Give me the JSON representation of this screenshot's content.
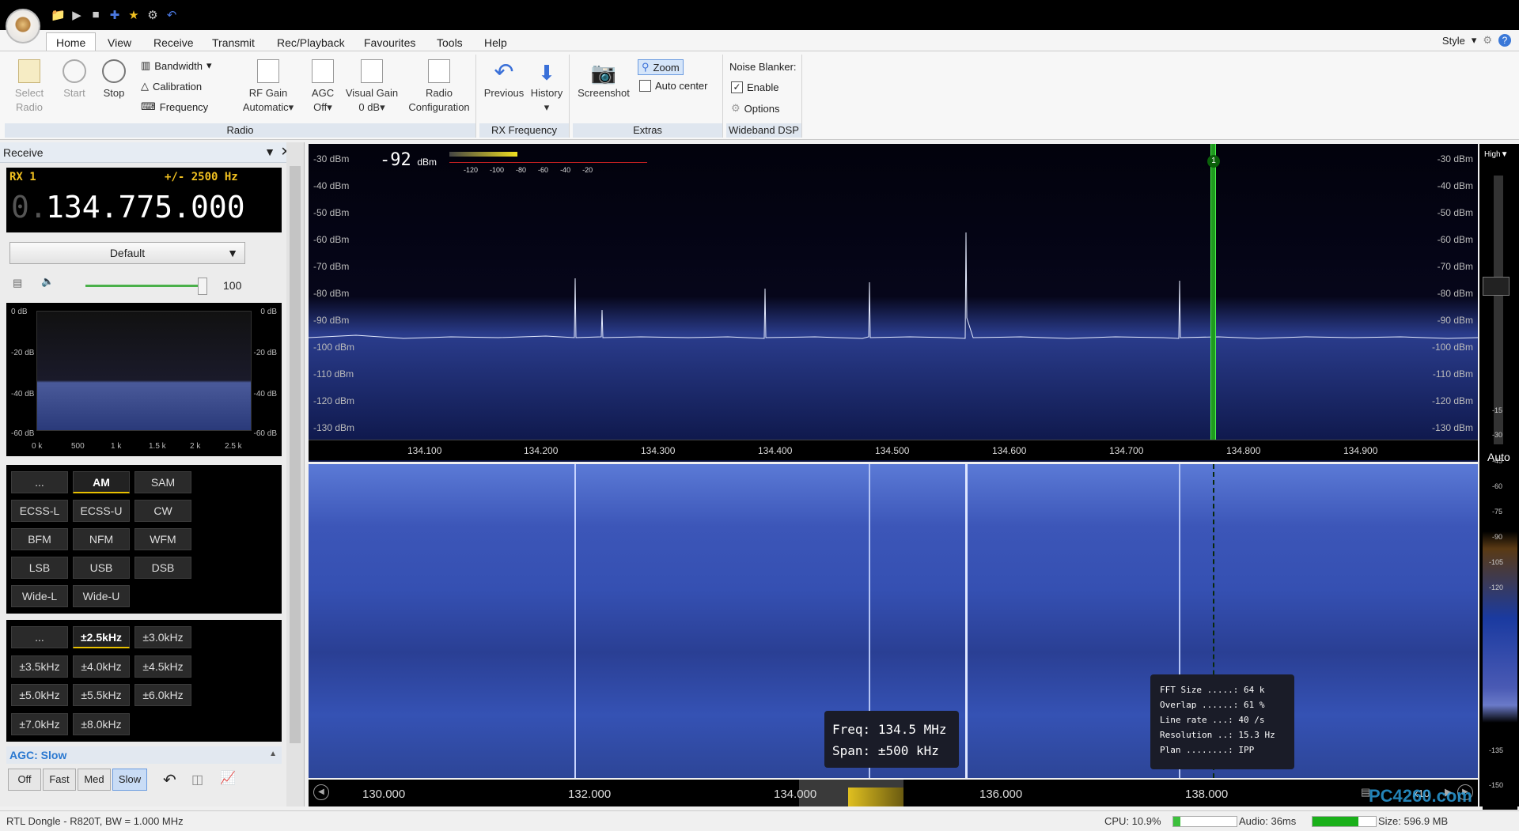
{
  "qat_icons": [
    "folder-icon",
    "play-icon",
    "stop-icon",
    "add-icon",
    "star-icon",
    "gear-icon",
    "undo-icon"
  ],
  "menu": {
    "tabs": [
      "Home",
      "View",
      "Receive",
      "Transmit",
      "Rec/Playback",
      "Favourites",
      "Tools",
      "Help"
    ],
    "active": "Home",
    "style_label": "Style"
  },
  "ribbon": {
    "radio": {
      "select_radio": "Select Radio",
      "start": "Start",
      "stop": "Stop",
      "bandwidth": "Bandwidth",
      "calibration": "Calibration",
      "frequency": "Frequency",
      "rf_gain": "RF Gain",
      "rf_gain_value": "Automatic",
      "agc": "AGC",
      "agc_value": "Off",
      "visual_gain": "Visual Gain",
      "visual_gain_value": "0 dB",
      "radio_configuration": "Radio Configuration",
      "group_label": "Radio"
    },
    "rx_frequency": {
      "previous": "Previous",
      "history": "History",
      "group_label": "RX Frequency"
    },
    "extras": {
      "screenshot": "Screenshot",
      "zoom": "Zoom",
      "auto_center": "Auto center",
      "group_label": "Extras"
    },
    "wideband_dsp": {
      "noise_blanker": "Noise Blanker:",
      "enable": "Enable",
      "options": "Options",
      "group_label": "Wideband DSP"
    }
  },
  "receive_panel": {
    "title": "Receive",
    "rx_label": "RX 1",
    "bandwidth_readout": "+/- 2500 Hz",
    "freq_prefix": "0.",
    "frequency": "134.775.000",
    "profile": "Default",
    "volume": "100",
    "audio_spectrum": {
      "db_labels": [
        "0 dB",
        "-20 dB",
        "-40 dB",
        "-60 dB"
      ],
      "x_labels": [
        "0 k",
        "500",
        "1 k",
        "1.5 k",
        "2 k",
        "2.5 k"
      ]
    },
    "modes": [
      "...",
      "AM",
      "SAM",
      "ECSS-L",
      "ECSS-U",
      "CW",
      "BFM",
      "NFM",
      "WFM",
      "LSB",
      "USB",
      "DSB",
      "Wide-L",
      "Wide-U"
    ],
    "active_mode": "AM",
    "filters": [
      "...",
      "±2.5kHz",
      "±3.0kHz",
      "±3.5kHz",
      "±4.0kHz",
      "±4.5kHz",
      "±5.0kHz",
      "±5.5kHz",
      "±6.0kHz",
      "±7.0kHz",
      "±8.0kHz"
    ],
    "active_filter": "±2.5kHz",
    "agc_title": "AGC: Slow",
    "agc_buttons": [
      "Off",
      "Fast",
      "Med",
      "Slow"
    ],
    "agc_active": "Slow"
  },
  "spectrum": {
    "signal_level": "-92",
    "signal_unit": "dBm",
    "meter_scale": [
      "-120",
      "-100",
      "-80",
      "-60",
      "-40",
      "-20"
    ],
    "db_labels": [
      "-30 dBm",
      "-40 dBm",
      "-50 dBm",
      "-60 dBm",
      "-70 dBm",
      "-80 dBm",
      "-90 dBm",
      "-100 dBm",
      "-110 dBm",
      "-120 dBm",
      "-130 dBm"
    ],
    "freq_labels": [
      "134.100",
      "134.200",
      "134.300",
      "134.400",
      "134.500",
      "134.600",
      "134.700",
      "134.800",
      "134.900"
    ],
    "marker_label": "1",
    "range_label": "High",
    "auto_label": "Auto",
    "accent": "#22cc22"
  },
  "waterfall": {
    "tooltip_freq_label": "Freq:",
    "tooltip_freq": "134.5 MHz",
    "tooltip_span_label": "Span:",
    "tooltip_span": "±500 kHz",
    "stats": [
      {
        "k": "FFT Size .....:",
        "v": "64 k"
      },
      {
        "k": "Overlap ......:",
        "v": "61 %"
      },
      {
        "k": "Line rate ...:",
        "v": "40 /s"
      },
      {
        "k": "Resolution ..:",
        "v": "15.3 Hz"
      },
      {
        "k": "Plan ........:",
        "v": "IPP"
      }
    ],
    "scale_labels": [
      "-15",
      "-30",
      "-45",
      "-60",
      "-75",
      "-90",
      "-105",
      "-120",
      "-135",
      "-150"
    ],
    "overview_labels": [
      "130.000",
      "132.000",
      "134.000",
      "136.000",
      "138.000"
    ],
    "zoom_label": "x10",
    "watermark": "PC4260.com"
  },
  "status": {
    "device": "RTL Dongle - R820T, BW = 1.000 MHz",
    "cpu": "CPU: 10.9%",
    "audio": "Audio: 36ms",
    "size": "Size: 596.9 MB"
  }
}
